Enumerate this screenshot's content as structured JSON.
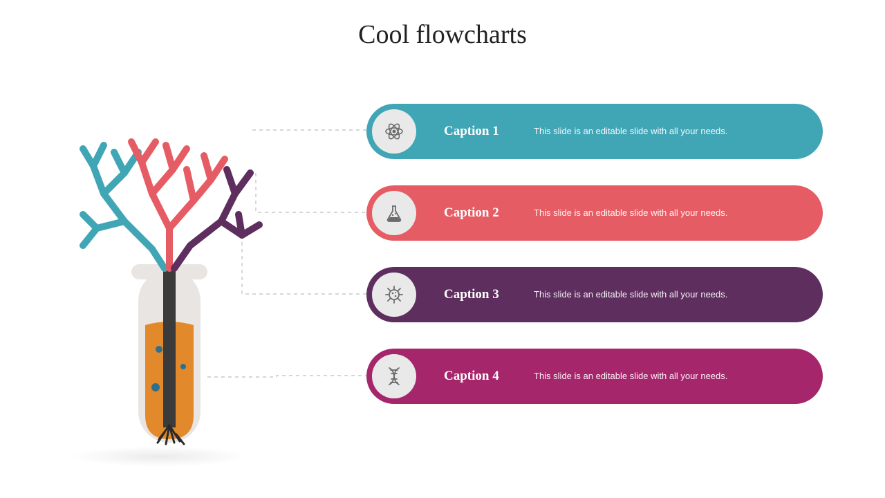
{
  "title": "Cool flowcharts",
  "items": [
    {
      "caption": "Caption 1",
      "desc": "This slide is an editable slide with all your needs.",
      "color": "#40a6b6",
      "icon": "atom-icon"
    },
    {
      "caption": "Caption 2",
      "desc": "This slide is an editable slide with all your needs.",
      "color": "#e65c64",
      "icon": "flask-icon"
    },
    {
      "caption": "Caption 3",
      "desc": "This slide is an editable slide with all your needs.",
      "color": "#5e2e5e",
      "icon": "microbe-icon"
    },
    {
      "caption": "Caption 4",
      "desc": "This slide is an editable slide with all your needs.",
      "color": "#a6266c",
      "icon": "dna-icon"
    }
  ],
  "branch_colors": {
    "teal": "#40a6b6",
    "coral": "#e65c64",
    "purple": "#5e2e5e"
  },
  "tube": {
    "liquid": "#e28a2b",
    "glass": "#e9e5e2",
    "dark": "#3b3b3b"
  }
}
